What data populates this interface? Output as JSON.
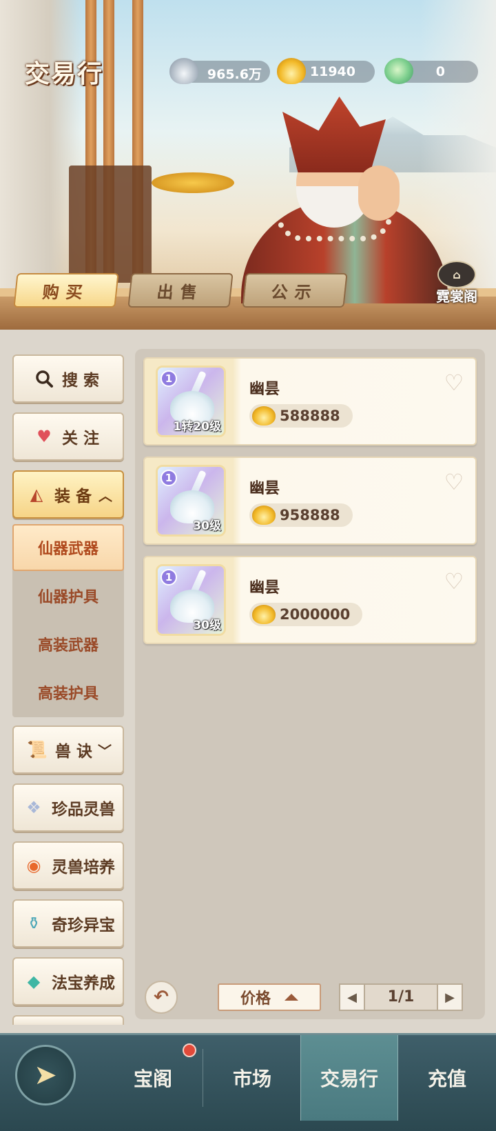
{
  "header": {
    "title": "交易行",
    "currencies": [
      {
        "icon": "silver-ingot-icon",
        "value": "965.6万"
      },
      {
        "icon": "gold-ingot-icon",
        "value": "11940"
      },
      {
        "icon": "jade-cloud-icon",
        "value": "0"
      }
    ],
    "tabs": [
      {
        "label": "购买",
        "active": true
      },
      {
        "label": "出售",
        "active": false
      },
      {
        "label": "公示",
        "active": false
      }
    ],
    "nishang_label": "霓裳阁"
  },
  "sidebar": {
    "search": "搜索",
    "follow": "关注",
    "equipment": "装备",
    "equipment_sub": [
      "仙器武器",
      "仙器护具",
      "高装武器",
      "高装护具"
    ],
    "beast_skill": "兽诀",
    "rare_beast": "珍品灵兽",
    "beast_train": "灵兽培养",
    "treasure": "奇珍异宝",
    "artifact": "法宝养成"
  },
  "listings": [
    {
      "name": "幽昙",
      "price": "588888",
      "tier": "1",
      "level": "1转20级"
    },
    {
      "name": "幽昙",
      "price": "958888",
      "tier": "1",
      "level": "30级"
    },
    {
      "name": "幽昙",
      "price": "2000000",
      "tier": "1",
      "level": "30级"
    }
  ],
  "footer": {
    "sort_label": "价格",
    "page": "1/1"
  },
  "bottom_nav": {
    "items": [
      "宝阁",
      "市场",
      "交易行",
      "充值"
    ],
    "active": "交易行"
  },
  "colors": {
    "accent_gold": "#f7d78a",
    "nav_bg": "#3f5f6a",
    "active_sub": "#f8d7aa"
  }
}
